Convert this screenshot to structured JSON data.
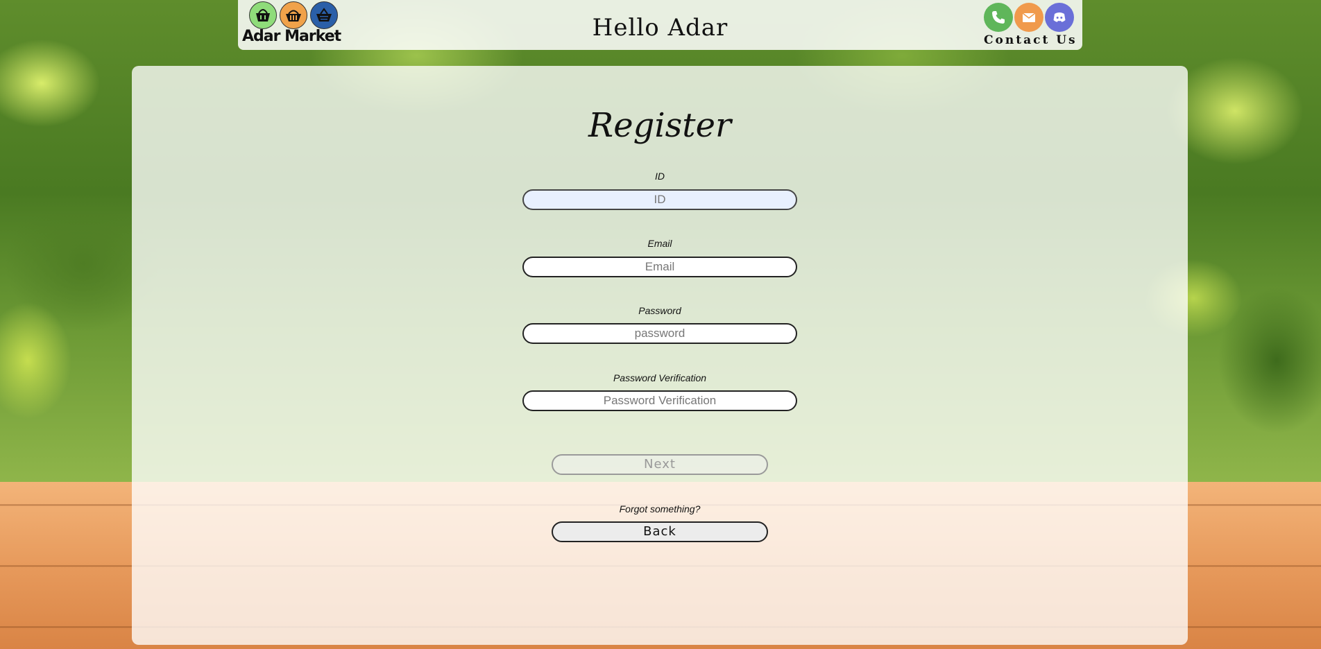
{
  "header": {
    "logo_text": "Adar Market",
    "greeting": "Hello Adar",
    "contact_label": "Contact Us",
    "contact_icons": [
      "phone-icon",
      "mail-icon",
      "discord-icon"
    ]
  },
  "form": {
    "title": "Register",
    "fields": [
      {
        "label": "ID",
        "placeholder": "ID",
        "value": ""
      },
      {
        "label": "Email",
        "placeholder": "Email",
        "value": ""
      },
      {
        "label": "Password",
        "placeholder": "password",
        "value": ""
      },
      {
        "label": "Password Verification",
        "placeholder": "Password Verification",
        "value": ""
      }
    ],
    "next_label": "Next",
    "forgot_text": "Forgot something?",
    "back_label": "Back"
  },
  "colors": {
    "basket_green": "#8fdc7a",
    "basket_orange": "#f0a24a",
    "basket_blue": "#2a5fa8",
    "phone": "#5fb65a",
    "mail": "#f09a4c",
    "discord": "#6a6fd8"
  }
}
